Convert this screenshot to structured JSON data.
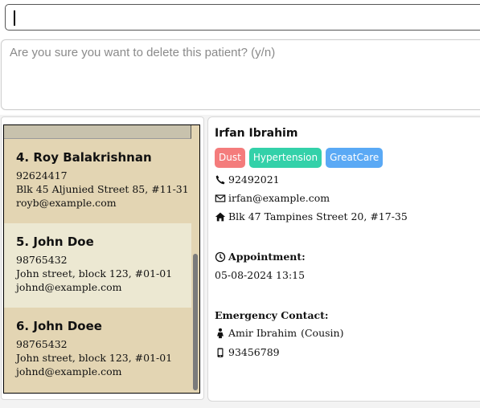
{
  "command_box": {
    "value": ""
  },
  "result_display": {
    "text": "Are you sure you want to delete this patient? (y/n)"
  },
  "patient_list": [
    {
      "index_name": "4. Roy Balakrishnan",
      "phone": "92624417",
      "address": "Blk 45 Aljunied Street 85, #11-31",
      "email": "royb@example.com"
    },
    {
      "index_name": "5. John Doe",
      "phone": "98765432",
      "address": "John street, block 123, #01-01",
      "email": "johnd@example.com"
    },
    {
      "index_name": "6. John Doee",
      "phone": "98765432",
      "address": "John street, block 123, #01-01",
      "email": "johnd@example.com"
    }
  ],
  "detail": {
    "name": "Irfan Ibrahim",
    "tags": [
      {
        "label": "Dust",
        "color": "#f47c7c"
      },
      {
        "label": "Hypertension",
        "color": "#33d1a9"
      },
      {
        "label": "GreatCare",
        "color": "#5aa9f5"
      }
    ],
    "phone": "92492021",
    "email": "irfan@example.com",
    "address": "Blk 47 Tampines Street 20, #17-35",
    "appointment_label": "Appointment:",
    "appointment": "05-08-2024 13:15",
    "emergency_label": "Emergency Contact:",
    "emergency_name": "Amir Ibrahim",
    "emergency_relation": "(Cousin)",
    "emergency_phone": "93456789"
  }
}
